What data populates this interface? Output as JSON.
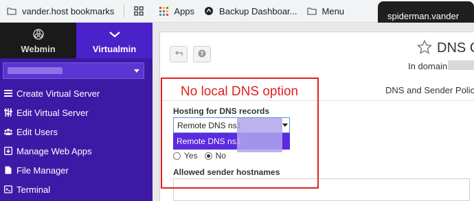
{
  "bookmarks": [
    {
      "label": "vander.host bookmarks",
      "icon": "folder-icon"
    },
    {
      "label": "",
      "icon": "apps-grid-icon"
    },
    {
      "label": "Apps",
      "icon": "google-apps-icon"
    },
    {
      "label": "Backup Dashboar...",
      "icon": "backup-icon"
    },
    {
      "label": "Menu",
      "icon": "folder-icon"
    }
  ],
  "tooltip": {
    "text": "spiderman.vander"
  },
  "sidebar": {
    "tabs": [
      {
        "label": "Webmin"
      },
      {
        "label": "Virtualmin"
      }
    ],
    "items": [
      {
        "label": "Create Virtual Server",
        "icon": "bars-icon"
      },
      {
        "label": "Edit Virtual Server",
        "icon": "sliders-icon"
      },
      {
        "label": "Edit Users",
        "icon": "users-icon"
      },
      {
        "label": "Manage Web Apps",
        "icon": "download-box-icon"
      },
      {
        "label": "File Manager",
        "icon": "file-icon"
      },
      {
        "label": "Terminal",
        "icon": "terminal-icon"
      }
    ]
  },
  "main": {
    "title": "DNS C",
    "in_domain": "In domain",
    "section_title": "DNS and Sender Polic",
    "hosting_label": "Hosting for DNS records",
    "hosting_selected": "Remote DNS ns1.",
    "hosting_option": "Remote DNS ns1.",
    "radio_yes": "Yes",
    "radio_no": "No",
    "radio_selected": "No",
    "sender_label": "Allowed sender hostnames"
  },
  "annotation": {
    "text": "No local DNS option",
    "color": "#e02020"
  },
  "colors": {
    "sidebar": "#3c1aa6",
    "accent": "#5a2be0"
  }
}
